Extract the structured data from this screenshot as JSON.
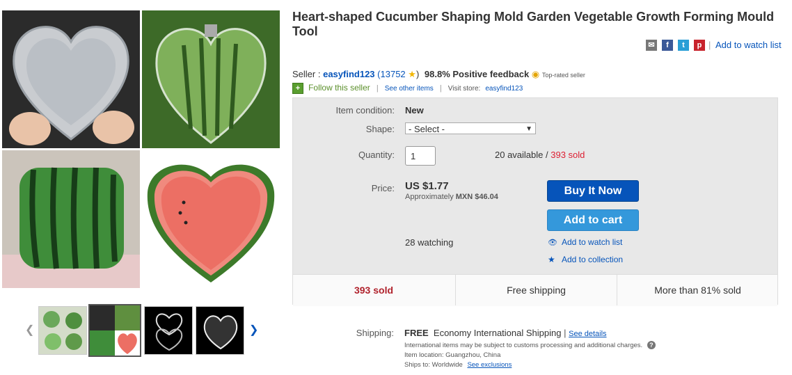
{
  "title": "Heart-shaped Cucumber Shaping Mold Garden Vegetable Growth Forming Mould Tool",
  "share": {
    "icons": [
      "email-icon",
      "facebook-icon",
      "twitter-icon",
      "pinterest-icon"
    ],
    "watch_label": "Add to watch list"
  },
  "seller": {
    "prefix": "Seller :",
    "name": "easyfind123",
    "count_open": "(",
    "count": "13752",
    "count_close": ")",
    "feedback": "98.8% Positive feedback",
    "badge": "Top-rated seller",
    "follow": "Follow this seller",
    "sep1": "|",
    "other_items": "See other items",
    "sep2": "|",
    "visit_store": "Visit store:",
    "store": "easyfind123"
  },
  "item": {
    "condition_label": "Item condition:",
    "condition": "New",
    "shape_label": "Shape:",
    "shape_value": "- Select -",
    "quantity_label": "Quantity:",
    "quantity": "1",
    "available": "20 available /",
    "sold_inline": "393 sold",
    "price_label": "Price:",
    "price": "US $1.77",
    "approx_prefix": "Approximately",
    "approx_value": "MXN $46.04",
    "watching": "28 watching"
  },
  "actions": {
    "buy_now": "Buy It Now",
    "add_cart": "Add to cart",
    "watch": "Add to watch list",
    "collection": "Add to collection"
  },
  "stats": {
    "sold": "393 sold",
    "shipping": "Free shipping",
    "more": "More than 81% sold"
  },
  "shipping": {
    "label": "Shipping:",
    "free": "FREE",
    "method": "Economy International Shipping",
    "sep": "|",
    "details": "See details",
    "note": "International items may be subject to customs processing and additional charges.",
    "location_label": "Item location:",
    "location": "Guangzhou, China",
    "ships_label": "Ships to:",
    "ships": "Worldwide",
    "exclusions": "See exclusions"
  },
  "colors": {
    "link": "#0654ba",
    "sold_red": "#dd1e31",
    "buy_button": "#0654ba",
    "cart_button": "#3498db"
  }
}
